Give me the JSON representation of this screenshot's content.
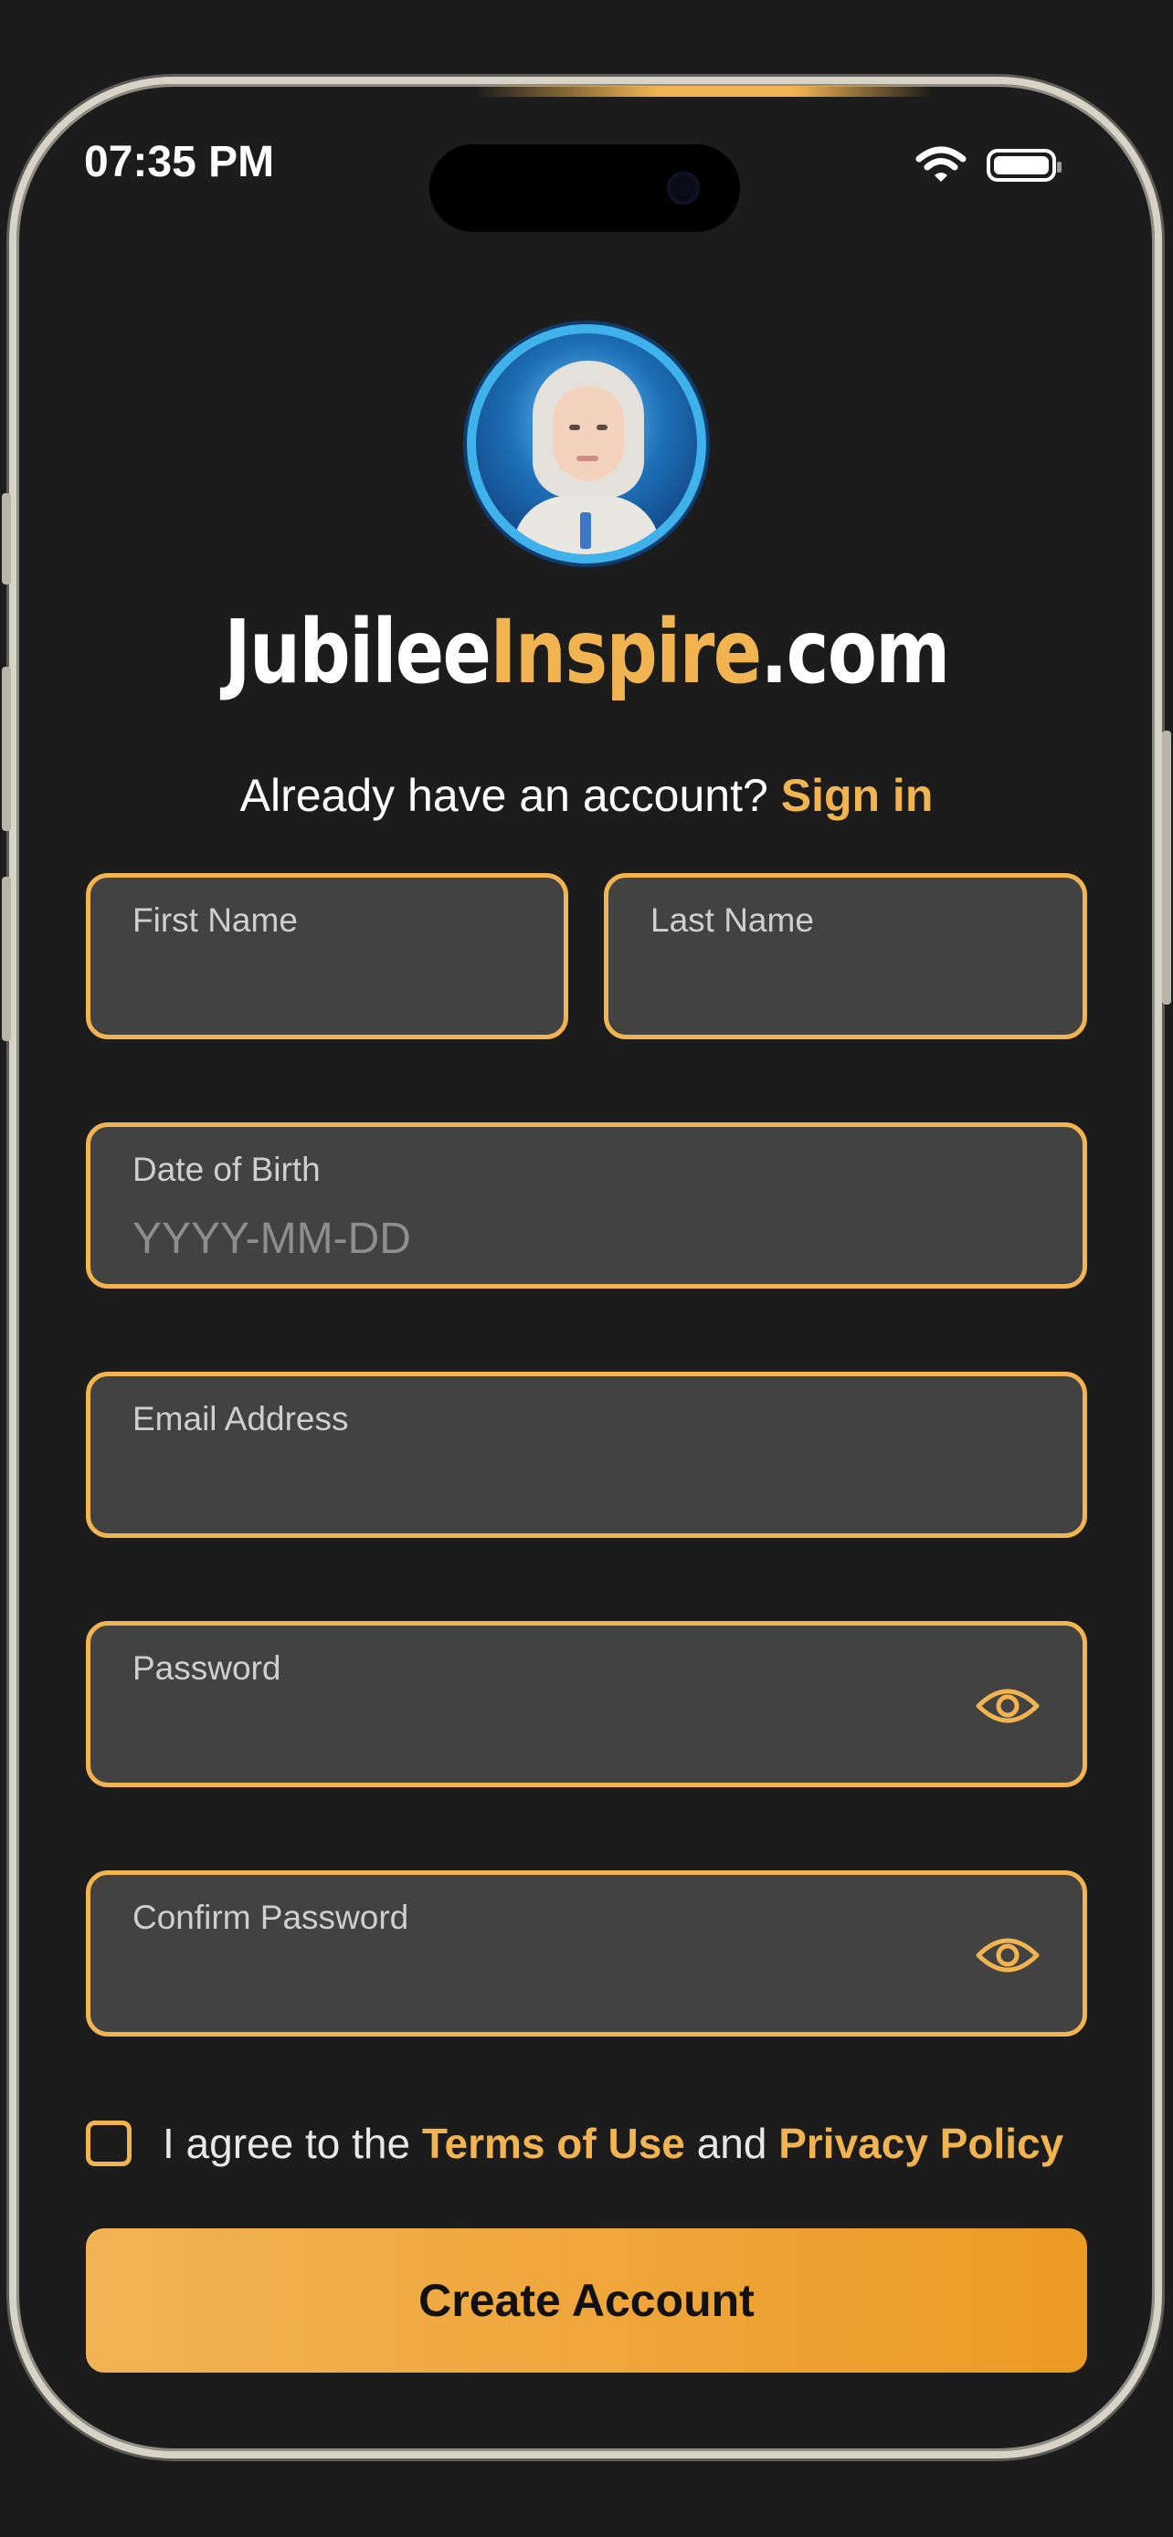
{
  "status_bar": {
    "time": "07:35 PM"
  },
  "brand": {
    "part1": "Jubilee",
    "part2": "Inspire",
    "part3": ".com"
  },
  "signin_prompt": {
    "text": "Already have an account?",
    "link": "Sign in"
  },
  "form": {
    "first_name": {
      "label": "First Name",
      "value": "",
      "placeholder": ""
    },
    "last_name": {
      "label": "Last Name",
      "value": "",
      "placeholder": ""
    },
    "dob": {
      "label": "Date of Birth",
      "value": "",
      "placeholder": "YYYY-MM-DD"
    },
    "email": {
      "label": "Email Address",
      "value": "",
      "placeholder": ""
    },
    "password": {
      "label": "Password",
      "value": "",
      "placeholder": ""
    },
    "confirm_password": {
      "label": "Confirm Password",
      "value": "",
      "placeholder": ""
    }
  },
  "agreement": {
    "prefix": "I agree to the",
    "terms": "Terms of Use",
    "and": "and",
    "privacy": "Privacy Policy",
    "checked": false
  },
  "cta": {
    "label": "Create Account"
  },
  "colors": {
    "accent": "#f2b451",
    "field_bg": "#424242",
    "background": "#1c1c1c",
    "avatar_ring": "#3fb2ec"
  },
  "icons": [
    "wifi-icon",
    "battery-icon",
    "eye-icon"
  ]
}
